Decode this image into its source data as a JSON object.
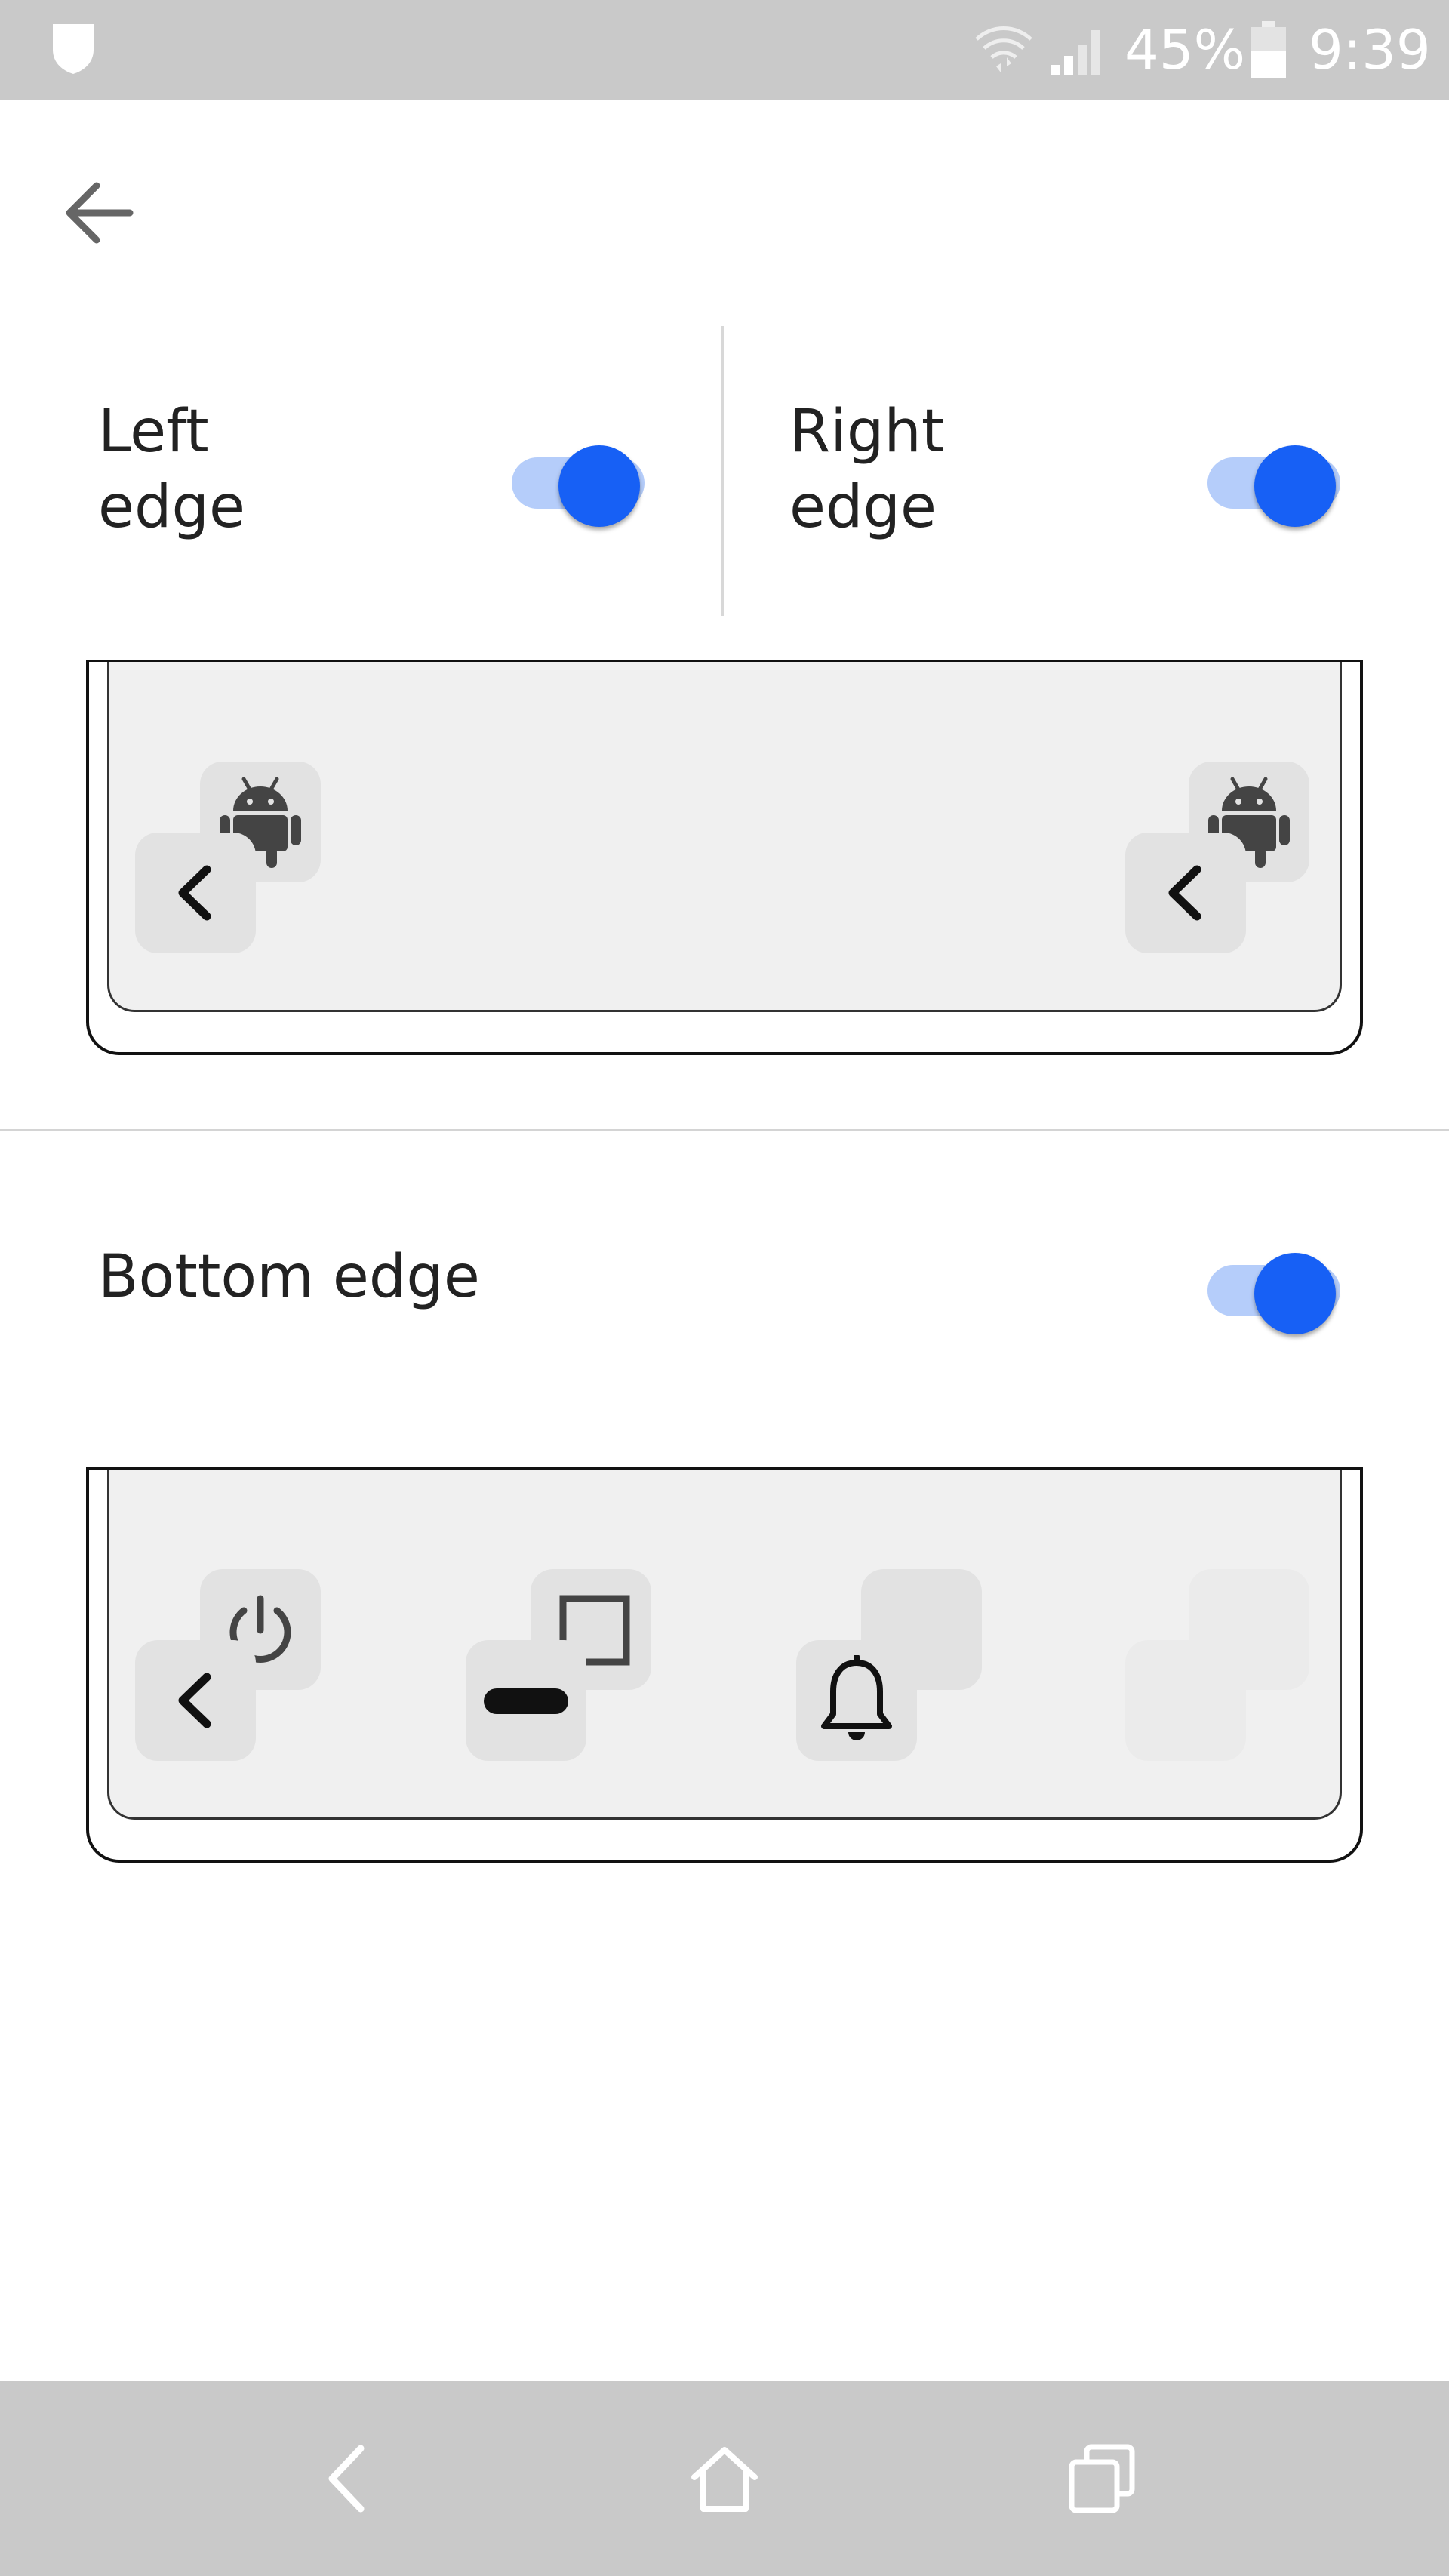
{
  "status_bar": {
    "battery_percent": "45%",
    "time": "9:39",
    "icons": [
      "shield-icon",
      "wifi-icon",
      "signal-icon",
      "battery-icon"
    ]
  },
  "header": {
    "back_icon": "arrow-left-icon"
  },
  "left_edge": {
    "label": "Left\nedge",
    "enabled": true
  },
  "right_edge": {
    "label": "Right\nedge",
    "enabled": true
  },
  "bottom_edge": {
    "label": "Bottom edge",
    "enabled": true
  },
  "side_preview": {
    "left_tiles": [
      "android-icon",
      "chevron-left-icon"
    ],
    "right_tiles": [
      "android-icon",
      "chevron-left-icon"
    ]
  },
  "bottom_preview": {
    "tiles": [
      "power-icon",
      "chevron-left-icon",
      "square-icon",
      "minus-bar-icon",
      "empty",
      "bell-icon",
      "empty",
      "empty"
    ]
  },
  "nav_bar": {
    "icons": [
      "back-icon",
      "home-icon",
      "recents-icon"
    ]
  },
  "colors": {
    "accent": "#1760f5",
    "accent_track": "#b5cdfa",
    "bar_gray": "#c9c9c9",
    "tile_gray": "#e2e2e2"
  }
}
